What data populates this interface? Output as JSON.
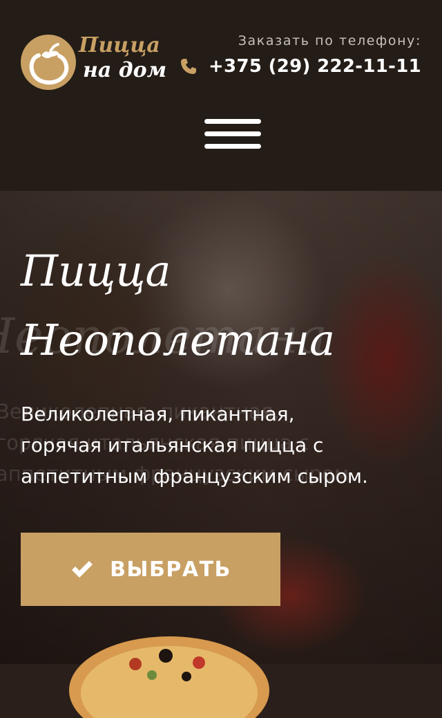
{
  "header": {
    "logo": {
      "line1": "Пицца",
      "line2": "на дом"
    },
    "phone_label": "Заказать по телефону:",
    "phone_number": "+375 (29) 222-11-11",
    "phone_icon": "phone-icon",
    "menu_icon": "hamburger-menu-icon"
  },
  "hero": {
    "title_line1": "Пицца",
    "title_line2": "Неополетана",
    "description_lines": [
      "Великолепная, пикантная,",
      "горячая итальянская пицца с",
      "аппетитным французским сыром."
    ],
    "button_label": "ВЫБРАТЬ",
    "button_icon": "checkmark-icon"
  },
  "colors": {
    "accent": "#c8a064",
    "header_bg": "#231c17",
    "text": "#ffffff"
  }
}
